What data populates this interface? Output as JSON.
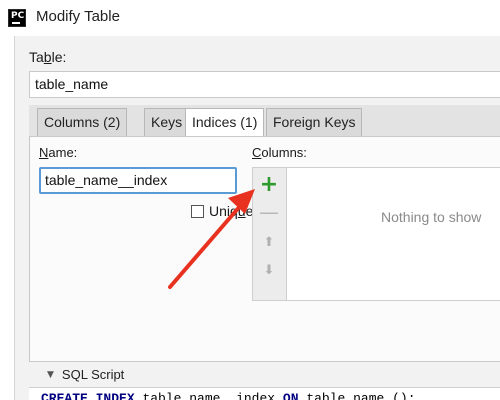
{
  "window": {
    "icon_text": "PC",
    "title": "Modify Table"
  },
  "table": {
    "label_prefix": "Ta",
    "label_underlined": "b",
    "label_suffix": "le:",
    "value": "table_name"
  },
  "tabs": [
    {
      "label": "Columns (2)"
    },
    {
      "label": "Keys"
    },
    {
      "label": "Indices (1)"
    },
    {
      "label": "Foreign Keys"
    }
  ],
  "active_tab_index": 2,
  "indices": {
    "name_label_underlined": "N",
    "name_label_rest": "ame:",
    "name_value": "table_name__index",
    "unique_label_prefix": "Uniq",
    "unique_label_underlined": "u",
    "unique_label_suffix": "e",
    "unique_checked": false,
    "columns_label_underlined": "C",
    "columns_label_rest": "olumns:",
    "empty_text": "Nothing to show",
    "toolbar": {
      "add_glyph": "+",
      "remove_glyph": "—",
      "up_glyph": "⬆",
      "down_glyph": "⬇"
    }
  },
  "sql": {
    "title": "SQL Script",
    "collapse_glyph": "▼",
    "kw_create": "CREATE",
    "kw_index": "INDEX",
    "index_name": "table_name__index",
    "kw_on": "ON",
    "table_ref": "table_name ();"
  },
  "colors": {
    "accent_focus": "#5b9bd5",
    "add_green": "#2e9a2e",
    "annotation_red": "#e8311f"
  }
}
